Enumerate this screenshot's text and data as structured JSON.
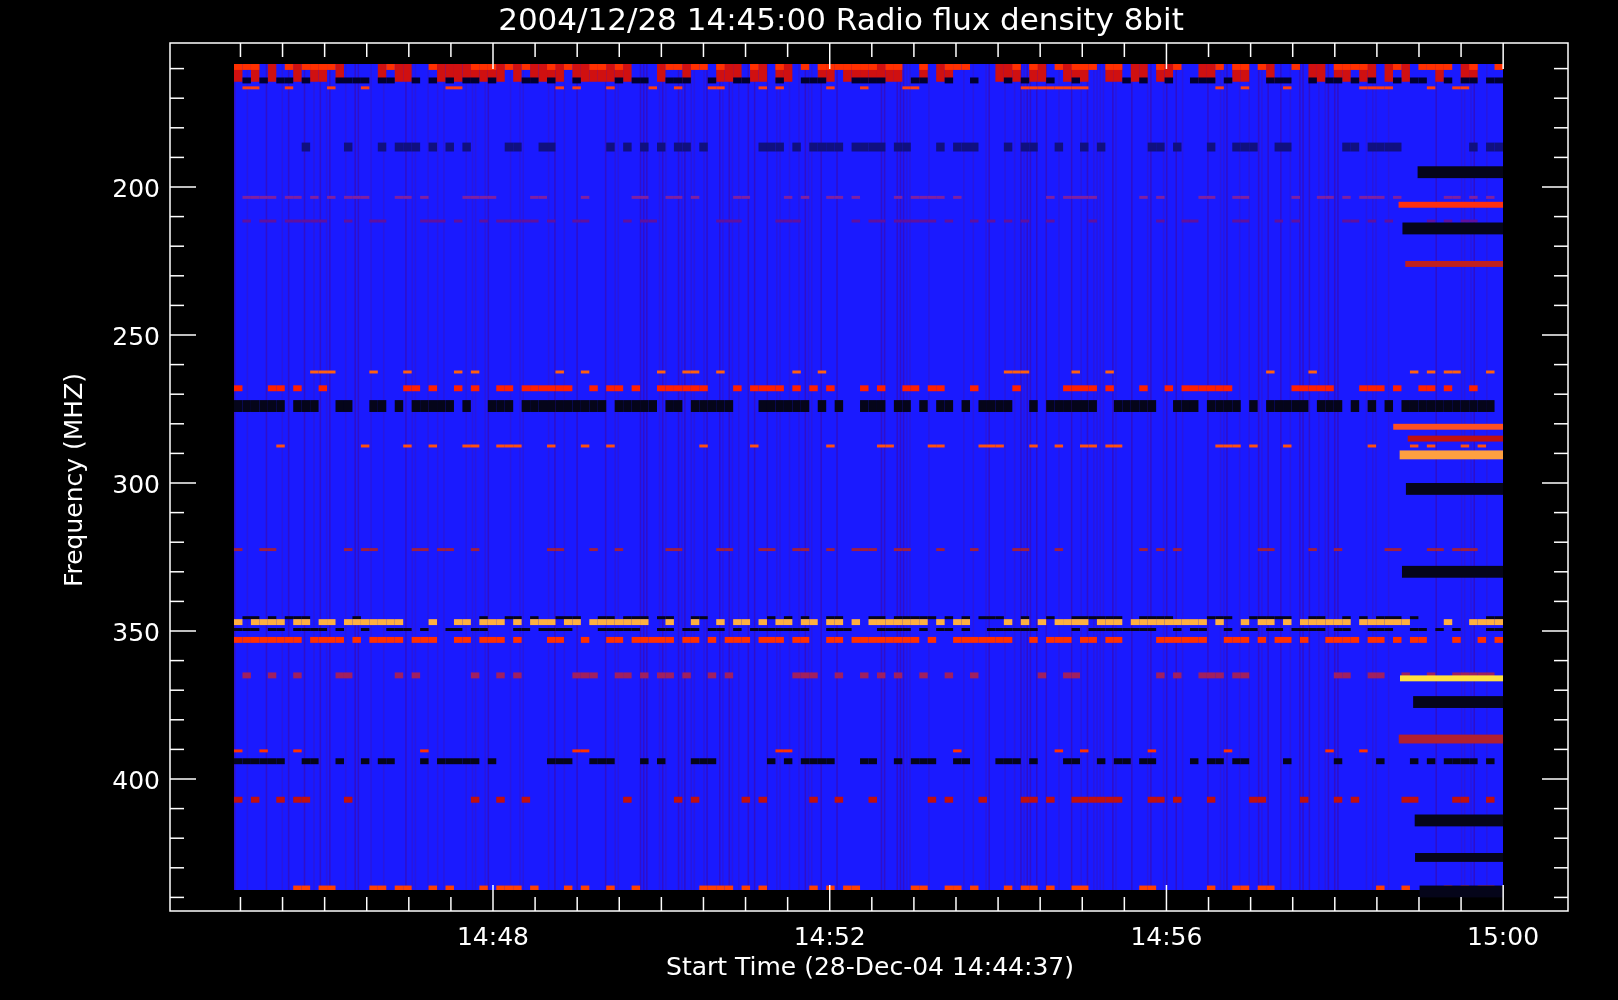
{
  "title": "2004/12/28 14:45:00 Radio flux density 8bit",
  "y_axis": {
    "label": "Frequency (MHZ)",
    "ticks": [
      "200",
      "250",
      "300",
      "350",
      "400"
    ]
  },
  "x_axis": {
    "label": "Start Time (28-Dec-04 14:44:37)",
    "ticks": [
      "14:48",
      "14:52",
      "14:56",
      "15:00"
    ]
  }
}
